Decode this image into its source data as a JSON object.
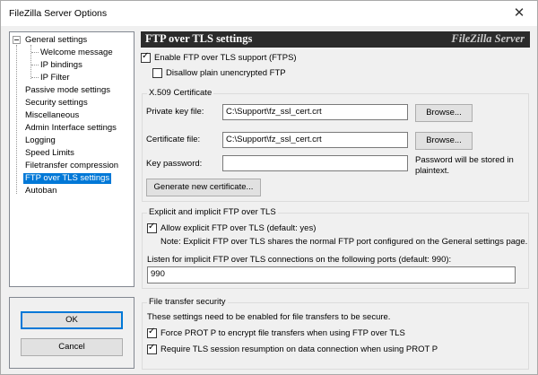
{
  "window": {
    "title": "FileZilla Server Options"
  },
  "tree": {
    "items": [
      {
        "label": "General settings"
      },
      {
        "label": "Welcome message"
      },
      {
        "label": "IP bindings"
      },
      {
        "label": "IP Filter"
      },
      {
        "label": "Passive mode settings"
      },
      {
        "label": "Security settings"
      },
      {
        "label": "Miscellaneous"
      },
      {
        "label": "Admin Interface settings"
      },
      {
        "label": "Logging"
      },
      {
        "label": "Speed Limits"
      },
      {
        "label": "Filetransfer compression"
      },
      {
        "label": "FTP over TLS settings"
      },
      {
        "label": "Autoban"
      }
    ]
  },
  "buttons": {
    "ok": "OK",
    "cancel": "Cancel"
  },
  "header": {
    "title": "FTP over TLS settings",
    "brand": "FileZilla Server"
  },
  "tls": {
    "enable_label": "Enable FTP over TLS support (FTPS)",
    "enable_checked": true,
    "disallow_label": "Disallow plain unencrypted FTP",
    "disallow_checked": false
  },
  "x509": {
    "group_label": "X.509 Certificate",
    "private_key_label": "Private key file:",
    "private_key_value": "C:\\Support\\fz_ssl_cert.crt",
    "certificate_label": "Certificate file:",
    "certificate_value": "C:\\Support\\fz_ssl_cert.crt",
    "browse_label": "Browse...",
    "key_password_label": "Key password:",
    "key_password_value": "",
    "password_note_line1": "Password will be stored in",
    "password_note_line2": "plaintext.",
    "generate_label": "Generate new certificate..."
  },
  "explicit": {
    "group_label": "Explicit and implicit FTP over TLS",
    "allow_label": "Allow explicit FTP over TLS (default: yes)",
    "allow_checked": true,
    "note": "Note: Explicit FTP over TLS shares the normal FTP port configured on the General settings page.",
    "ports_label": "Listen for implicit FTP over TLS connections on the following ports (default: 990):",
    "ports_value": "990"
  },
  "security": {
    "group_label": "File transfer security",
    "description": "These settings need to be enabled for file transfers to be secure.",
    "force_prot_label": "Force PROT P to encrypt file transfers when using FTP over TLS",
    "force_prot_checked": true,
    "require_resumption_label": "Require TLS session resumption on data connection when using PROT P",
    "require_resumption_checked": true
  }
}
